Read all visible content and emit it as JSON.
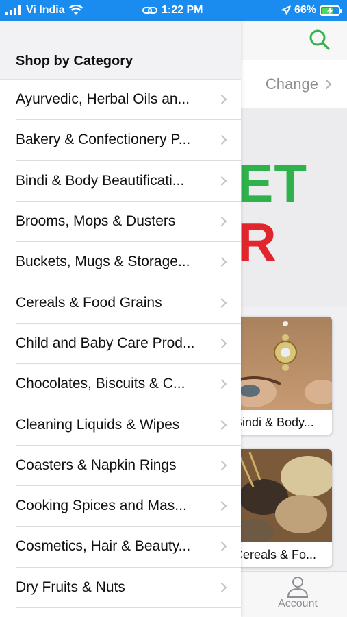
{
  "status_bar": {
    "carrier": "Vi India",
    "time": "1:22 PM",
    "battery": "66%",
    "battery_level": 0.66,
    "icons": [
      "signal-bars-icon",
      "wifi-icon",
      "link-icon",
      "location-arrow-icon",
      "battery-charging-icon"
    ]
  },
  "background": {
    "change_label": "Change",
    "banner_line1": "KET",
    "banner_line2": "AR",
    "cards": [
      "Bindi & Body...",
      "Cereals & Fo..."
    ],
    "tab_account_label": "Account"
  },
  "drawer": {
    "title": "Shop by Category",
    "categories": [
      "Ayurvedic, Herbal Oils an...",
      "Bakery & Confectionery P...",
      "Bindi & Body Beautificati...",
      "Brooms, Mops & Dusters",
      "Buckets, Mugs & Storage...",
      "Cereals & Food Grains",
      "Child and Baby Care Prod...",
      "Chocolates, Biscuits & C...",
      "Cleaning Liquids & Wipes",
      "Coasters & Napkin Rings",
      "Cooking Spices and Mas...",
      "Cosmetics, Hair & Beauty...",
      "Dry Fruits & Nuts"
    ]
  },
  "colors": {
    "status_bar": "#1a8cf0",
    "accent_green": "#2fb14b",
    "accent_red": "#e2252d",
    "chevron": "#c4c4c8"
  }
}
